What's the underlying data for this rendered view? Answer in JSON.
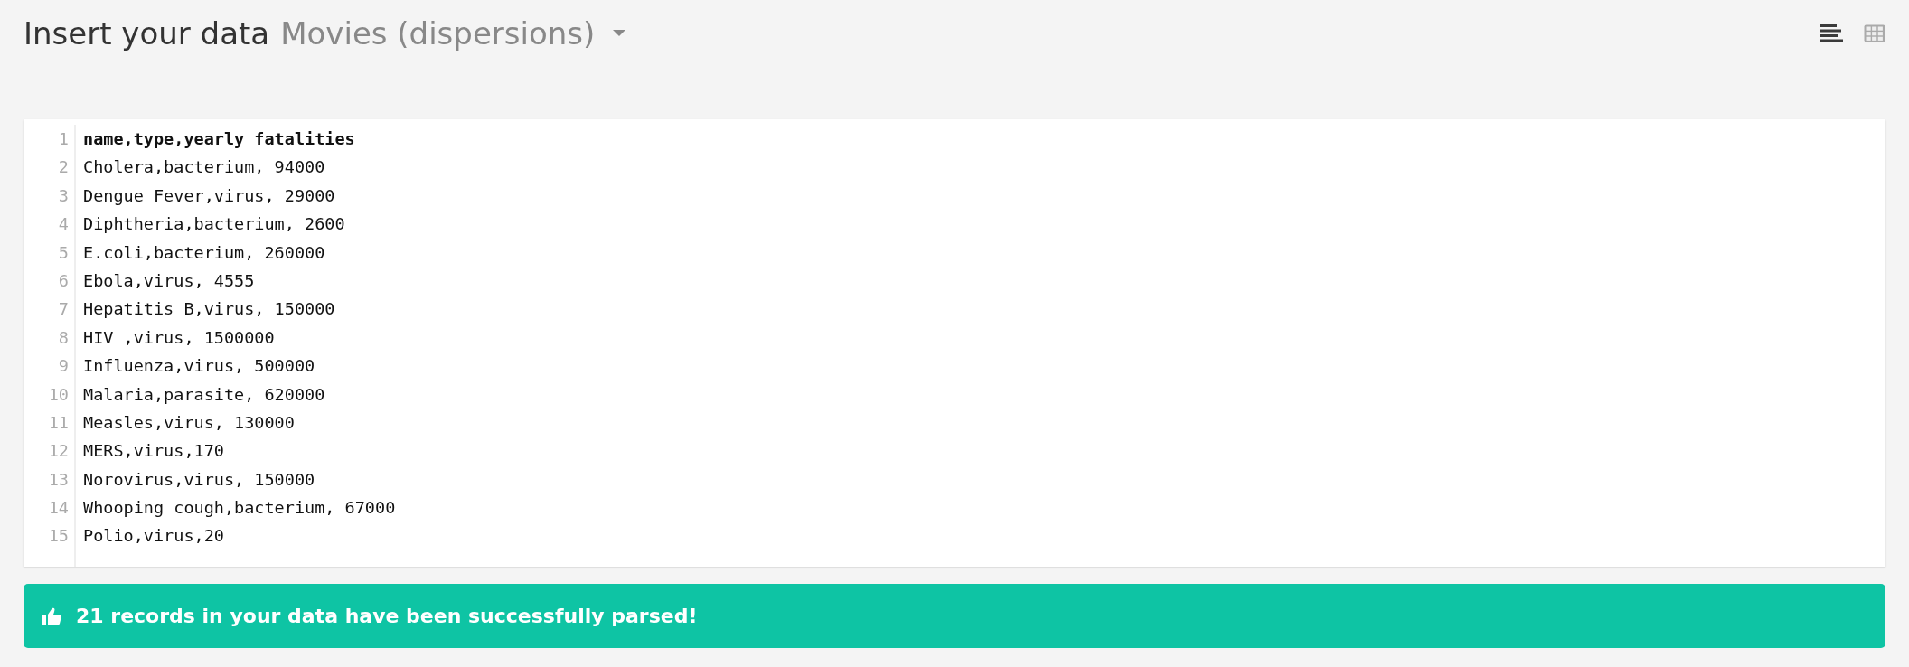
{
  "header": {
    "title": "Insert your data",
    "dataset": "Movies (dispersions)"
  },
  "views": [
    {
      "kind": "text",
      "selected": true
    },
    {
      "kind": "grid",
      "selected": false
    }
  ],
  "editor": {
    "lines": [
      {
        "number": "1",
        "text": "name,type,yearly fatalities",
        "header": true
      },
      {
        "number": "2",
        "text": "Cholera,bacterium, 94000",
        "header": false
      },
      {
        "number": "3",
        "text": "Dengue Fever,virus, 29000",
        "header": false
      },
      {
        "number": "4",
        "text": "Diphtheria,bacterium, 2600",
        "header": false
      },
      {
        "number": "5",
        "text": "E.coli,bacterium, 260000",
        "header": false
      },
      {
        "number": "6",
        "text": "Ebola,virus, 4555",
        "header": false
      },
      {
        "number": "7",
        "text": "Hepatitis B,virus, 150000",
        "header": false
      },
      {
        "number": "8",
        "text": "HIV ,virus, 1500000",
        "header": false
      },
      {
        "number": "9",
        "text": "Influenza,virus, 500000",
        "header": false
      },
      {
        "number": "10",
        "text": "Malaria,parasite, 620000",
        "header": false
      },
      {
        "number": "11",
        "text": "Measles,virus, 130000",
        "header": false
      },
      {
        "number": "12",
        "text": "MERS,virus,170",
        "header": false
      },
      {
        "number": "13",
        "text": "Norovirus,virus, 150000",
        "header": false
      },
      {
        "number": "14",
        "text": "Whooping cough,bacterium, 67000",
        "header": false
      },
      {
        "number": "15",
        "text": "Polio,virus,20",
        "header": false
      }
    ]
  },
  "status": {
    "message": "**21** records in your data have been successfully parsed!"
  }
}
